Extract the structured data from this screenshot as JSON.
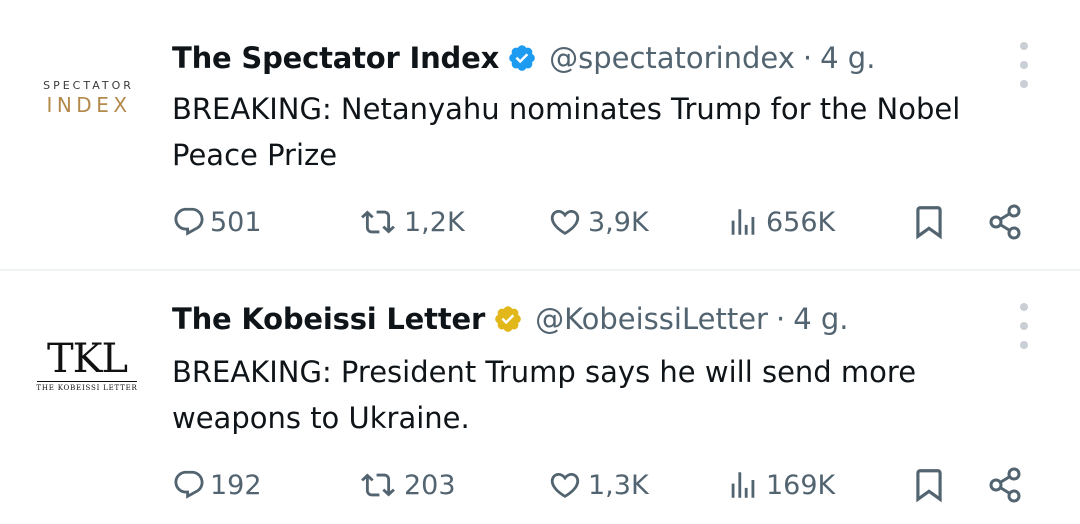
{
  "tweets": [
    {
      "display_name": "The Spectator Index",
      "verified_badge": "blue-check",
      "handle": "@spectatorindex",
      "separator": "·",
      "time": "4 g.",
      "avatar": {
        "line1": "SPECTATOR",
        "line2": "INDEX"
      },
      "text": "BREAKING: Netanyahu nominates Trump for the Nobel Peace Prize",
      "stats": {
        "replies": "501",
        "reposts": "1,2K",
        "likes": "3,9K",
        "views": "656K"
      }
    },
    {
      "display_name": "The Kobeissi Letter",
      "verified_badge": "gold-check",
      "handle": "@KobeissiLetter",
      "separator": "·",
      "time": "4 g.",
      "avatar": {
        "line1": "TKL",
        "line2": "THE KOBEISSI LETTER"
      },
      "text": "BREAKING: President Trump says he will send more weapons to Ukraine.",
      "stats": {
        "replies": "192",
        "reposts": "203",
        "likes": "1,3K",
        "views": "169K"
      }
    }
  ],
  "colors": {
    "text": "#0f1419",
    "muted": "#536471",
    "divider": "#eff3f4",
    "verified_blue": "#1d9bf0",
    "verified_gold": "#e2b719",
    "spectator_gold": "#b48a4c"
  },
  "icons": [
    "reply-icon",
    "repost-icon",
    "like-icon",
    "views-icon",
    "bookmark-icon",
    "share-icon",
    "more-icon"
  ]
}
